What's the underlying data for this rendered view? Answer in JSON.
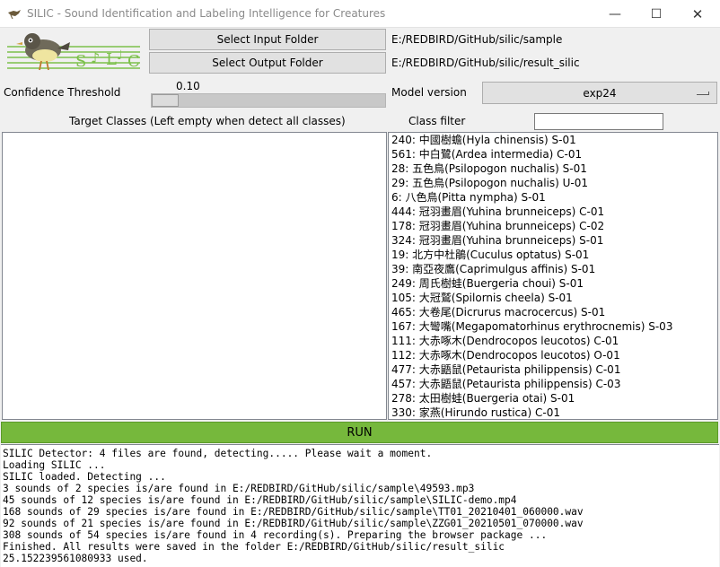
{
  "window": {
    "title": "SILIC - Sound Identification and Labeling Intelligence for Creatures",
    "minimize_glyph": "—",
    "maximize_glyph": "☐",
    "close_glyph": "✕"
  },
  "logo": {
    "text": "SILIC",
    "icon": "bird-logo"
  },
  "input": {
    "button_label": "Select Input Folder",
    "path": "E:/REDBIRD/GitHub/silic/sample"
  },
  "output": {
    "button_label": "Select Output Folder",
    "path": "E:/REDBIRD/GitHub/silic/result_silic"
  },
  "confidence": {
    "label": "Confidence Threshold",
    "value": "0.10",
    "fraction": 0.1
  },
  "model": {
    "label": "Model version",
    "value": "exp24"
  },
  "target_classes": {
    "label": "Target Classes (Left empty when detect all classes)"
  },
  "class_filter": {
    "label": "Class filter",
    "value": ""
  },
  "classes": [
    "240: 中國樹蟾(Hyla chinensis) S-01",
    "561: 中白鷺(Ardea intermedia) C-01",
    "28: 五色鳥(Psilopogon nuchalis) S-01",
    "29: 五色鳥(Psilopogon nuchalis) U-01",
    "6: 八色鳥(Pitta nympha) S-01",
    "444: 冠羽畫眉(Yuhina brunneiceps) C-01",
    "178: 冠羽畫眉(Yuhina brunneiceps) C-02",
    "324: 冠羽畫眉(Yuhina brunneiceps) S-01",
    "19: 北方中杜鵑(Cuculus optatus) S-01",
    "39: 南亞夜鷹(Caprimulgus affinis) S-01",
    "249: 周氏樹蛙(Buergeria choui) S-01",
    "105: 大冠鷲(Spilornis cheela) S-01",
    "465: 大卷尾(Dicrurus macrocercus) S-01",
    "167: 大彎嘴(Megapomatorhinus erythrocnemis) S-03",
    "111: 大赤啄木(Dendrocopos leucotos) C-01",
    "112: 大赤啄木(Dendrocopos leucotos) O-01",
    "477: 大赤鼯鼠(Petaurista philippensis) C-01",
    "457: 大赤鼯鼠(Petaurista philippensis) C-03",
    "278: 太田樹蛙(Buergeria otai) S-01",
    "330: 家燕(Hirundo rustica) C-01"
  ],
  "run": {
    "label": "RUN",
    "color": "#76b83c"
  },
  "log": [
    "SILIC Detector: 4 files are found, detecting..... Please wait a moment.",
    "Loading SILIC ...",
    "SILIC loaded. Detecting ...",
    "3 sounds of 2 species is/are found in E:/REDBIRD/GitHub/silic/sample\\49593.mp3",
    "45 sounds of 12 species is/are found in E:/REDBIRD/GitHub/silic/sample\\SILIC-demo.mp4",
    "168 sounds of 29 species is/are found in E:/REDBIRD/GitHub/silic/sample\\TT01_20210401_060000.wav",
    "92 sounds of 21 species is/are found in E:/REDBIRD/GitHub/silic/sample\\ZZG01_20210501_070000.wav",
    "308 sounds of 54 species is/are found in 4 recording(s). Preparing the browser package ...",
    "Finished. All results were saved in the folder E:/REDBIRD/GitHub/silic/result_silic",
    "25.152239561080933 used."
  ]
}
